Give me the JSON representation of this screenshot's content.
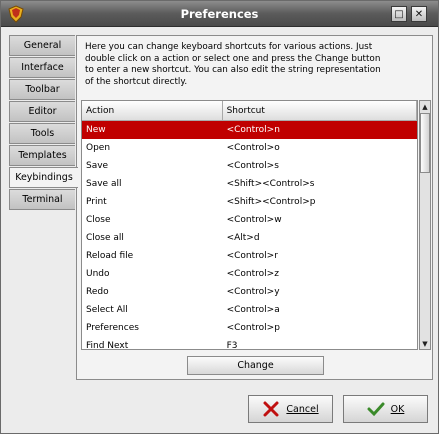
{
  "window": {
    "title": "Preferences"
  },
  "tabs": [
    {
      "label": "General"
    },
    {
      "label": "Interface"
    },
    {
      "label": "Toolbar"
    },
    {
      "label": "Editor"
    },
    {
      "label": "Tools"
    },
    {
      "label": "Templates"
    },
    {
      "label": "Keybindings",
      "active": true
    },
    {
      "label": "Terminal"
    }
  ],
  "keybindings": {
    "description": "Here you can change keyboard shortcuts for various actions. Just double click on a action or select one and press the Change button to enter a new shortcut. You can also edit the string representation of the shortcut directly.",
    "columns": {
      "action": "Action",
      "shortcut": "Shortcut"
    },
    "rows": [
      {
        "action": "New",
        "shortcut": "<Control>n",
        "selected": true
      },
      {
        "action": "Open",
        "shortcut": "<Control>o"
      },
      {
        "action": "Save",
        "shortcut": "<Control>s"
      },
      {
        "action": "Save all",
        "shortcut": "<Shift><Control>s"
      },
      {
        "action": "Print",
        "shortcut": "<Shift><Control>p"
      },
      {
        "action": "Close",
        "shortcut": "<Control>w"
      },
      {
        "action": "Close all",
        "shortcut": "<Alt>d"
      },
      {
        "action": "Reload file",
        "shortcut": "<Control>r"
      },
      {
        "action": "Undo",
        "shortcut": "<Control>z"
      },
      {
        "action": "Redo",
        "shortcut": "<Control>y"
      },
      {
        "action": "Select All",
        "shortcut": "<Control>a"
      },
      {
        "action": "Preferences",
        "shortcut": "<Control>p"
      },
      {
        "action": "Find Next",
        "shortcut": "F3"
      }
    ],
    "change_label": "Change"
  },
  "buttons": {
    "cancel": "Cancel",
    "ok": "OK"
  },
  "colors": {
    "selection": "#c00000",
    "titlebar": "#5b5b5b"
  }
}
